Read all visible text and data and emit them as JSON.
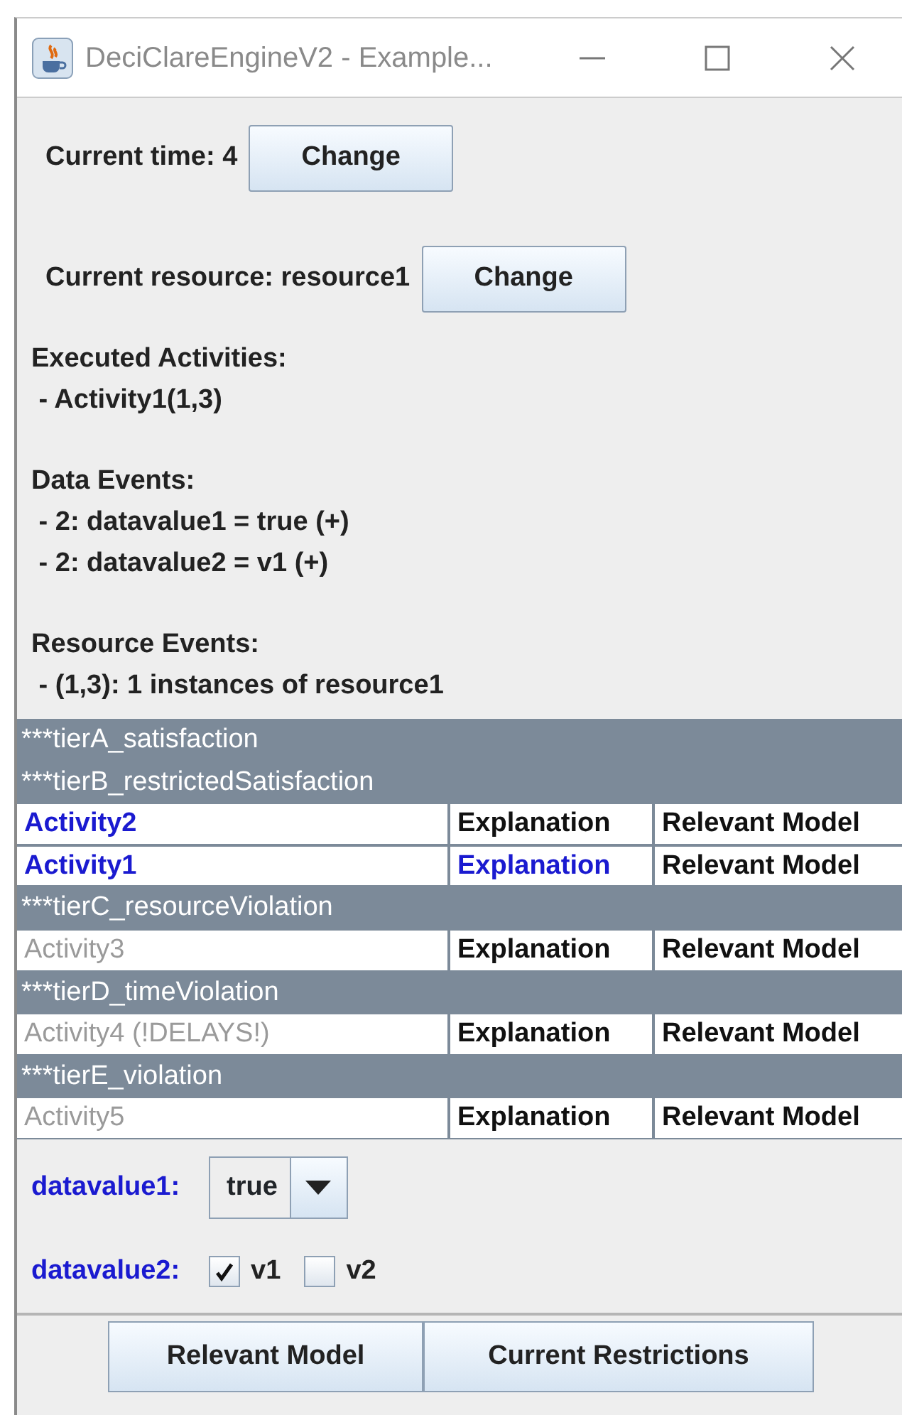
{
  "window": {
    "title": "DeciClareEngineV2 - Example..."
  },
  "time": {
    "label": "Current time: 4",
    "button": "Change"
  },
  "resource": {
    "label": "Current resource: resource1",
    "button": "Change"
  },
  "sections": [
    {
      "heading": "Executed Activities:",
      "items": [
        " - Activity1(1,3)"
      ]
    },
    {
      "heading": "Data Events:",
      "items": [
        " - 2: datavalue1 = true (+)",
        " - 2: datavalue2 = v1 (+)"
      ]
    },
    {
      "heading": "Resource Events:",
      "items": [
        " - (1,3): 1 instances of resource1"
      ]
    }
  ],
  "tiers": [
    {
      "label": "***tierA_satisfaction"
    },
    {
      "label": "***tierB_restrictedSatisfaction",
      "activities": [
        {
          "name": "Activity2",
          "enabled": true,
          "explanation": "Explanation",
          "explanation_highlighted": false,
          "model": "Relevant Model"
        },
        {
          "name": "Activity1",
          "enabled": true,
          "explanation": "Explanation",
          "explanation_highlighted": true,
          "model": "Relevant Model"
        }
      ]
    },
    {
      "label": "***tierC_resourceViolation",
      "activities": [
        {
          "name": "Activity3",
          "enabled": false,
          "explanation": "Explanation",
          "explanation_highlighted": false,
          "model": "Relevant Model"
        }
      ]
    },
    {
      "label": "***tierD_timeViolation",
      "activities": [
        {
          "name": "Activity4 (!DELAYS!)",
          "enabled": false,
          "explanation": "Explanation",
          "explanation_highlighted": false,
          "model": "Relevant Model"
        }
      ]
    },
    {
      "label": "***tierE_violation",
      "activities": [
        {
          "name": "Activity5",
          "enabled": false,
          "explanation": "Explanation",
          "explanation_highlighted": false,
          "model": "Relevant Model"
        }
      ]
    }
  ],
  "datavalue1": {
    "label": "datavalue1:",
    "value": "true"
  },
  "datavalue2": {
    "label": "datavalue2:",
    "options": [
      {
        "label": "v1",
        "checked": true
      },
      {
        "label": "v2",
        "checked": false
      }
    ]
  },
  "buttons": [
    "Relevant Model",
    "Current Restrictions"
  ]
}
